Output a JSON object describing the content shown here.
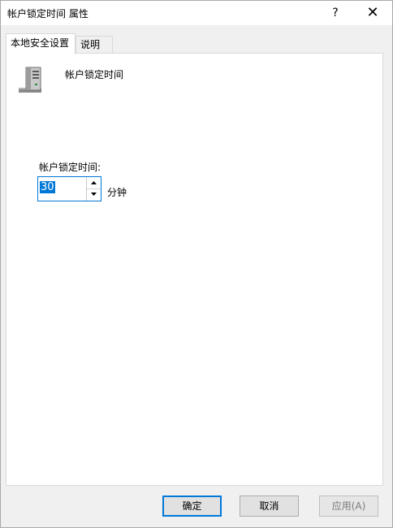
{
  "window": {
    "title": "帐户锁定时间 属性",
    "help_label": "?",
    "close_label": "✕"
  },
  "tabs": [
    {
      "label": "本地安全设置",
      "active": true
    },
    {
      "label": "说明",
      "active": false
    }
  ],
  "policy": {
    "icon": "server-icon",
    "name": "帐户锁定时间"
  },
  "field": {
    "label": "帐户锁定时间:",
    "value": "30",
    "unit": "分钟"
  },
  "buttons": {
    "ok": "确定",
    "cancel": "取消",
    "apply": "应用(A)"
  },
  "colors": {
    "accent": "#0078d7",
    "dialog_bg": "#f0f0f0"
  }
}
